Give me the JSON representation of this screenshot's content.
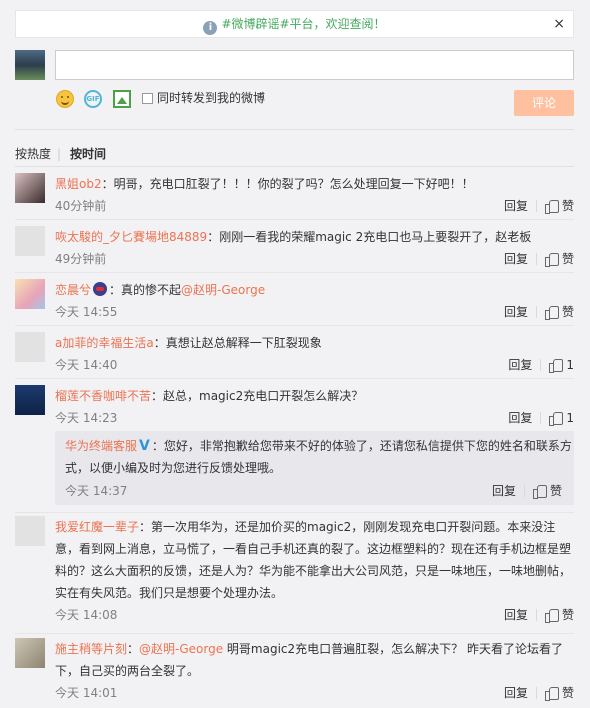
{
  "notice": {
    "text": "#微博辟谣#平台，欢迎查阅！",
    "close": "×"
  },
  "composer": {
    "forward_label": "同时转发到我的微博",
    "submit_label": "评论"
  },
  "sort": {
    "hot": "按热度",
    "separator": "|",
    "time": "按时间"
  },
  "actions": {
    "reply": "回复",
    "like": "赞"
  },
  "comments": [
    {
      "name": "黑姐ob2",
      "text": "：明哥，充电口肛裂了！！！你的裂了吗？怎么处理回复一下好吧！！",
      "time": "40分钟前",
      "likes": "赞"
    },
    {
      "name": "咴太駿的_夕匕賽場地84889",
      "text": "：刚刚一看我的荣耀magic 2充电口也马上要裂开了，赵老板",
      "time": "49分钟前",
      "likes": "赞"
    },
    {
      "name": "恋晨兮",
      "text_before": "：真的惨不起",
      "mention": "@赵明-George",
      "time": "今天 14:55",
      "likes": "赞"
    },
    {
      "name": "a加菲的幸福生活a",
      "text": "：真想让赵总解释一下肛裂现象",
      "time": "今天 14:40",
      "likes": "1"
    },
    {
      "name": "榴莲不香咖啡不苦",
      "text": "：赵总，magic2充电口开裂怎么解决？",
      "time": "今天 14:23",
      "likes": "1"
    },
    {
      "name": "我爱红魔一辈子",
      "text": "：第一次用华为，还是加价买的magic2，刚刚发现充电口开裂问题。本来没注意，看到网上消息，立马慌了，一看自己手机还真的裂了。这边框塑料的？现在还有手机边框是塑料的？这么大面积的反馈，还是人为？华为能不能拿出大公司风范，只是一味地压，一味地删帖，实在有失风范。我们只是想要个处理办法。",
      "time": "今天 14:08",
      "likes": "赞"
    },
    {
      "name": "施主稍等片刻",
      "mention": "@赵明-George",
      "text_after": " 明哥magic2充电口普遍肛裂，怎么解决下？ 昨天看了论坛看了下，自己买的两台全裂了。",
      "time": "今天 14:01",
      "likes": "赞"
    }
  ],
  "official_reply": {
    "name": "华为终端客服",
    "badge": "V",
    "text": "：您好，非常抱歉给您带来不好的体验了，还请您私信提供下您的姓名和联系方式，以便小编及时为您进行反馈处理哦。",
    "time": "今天 14:37",
    "likes": "赞"
  }
}
